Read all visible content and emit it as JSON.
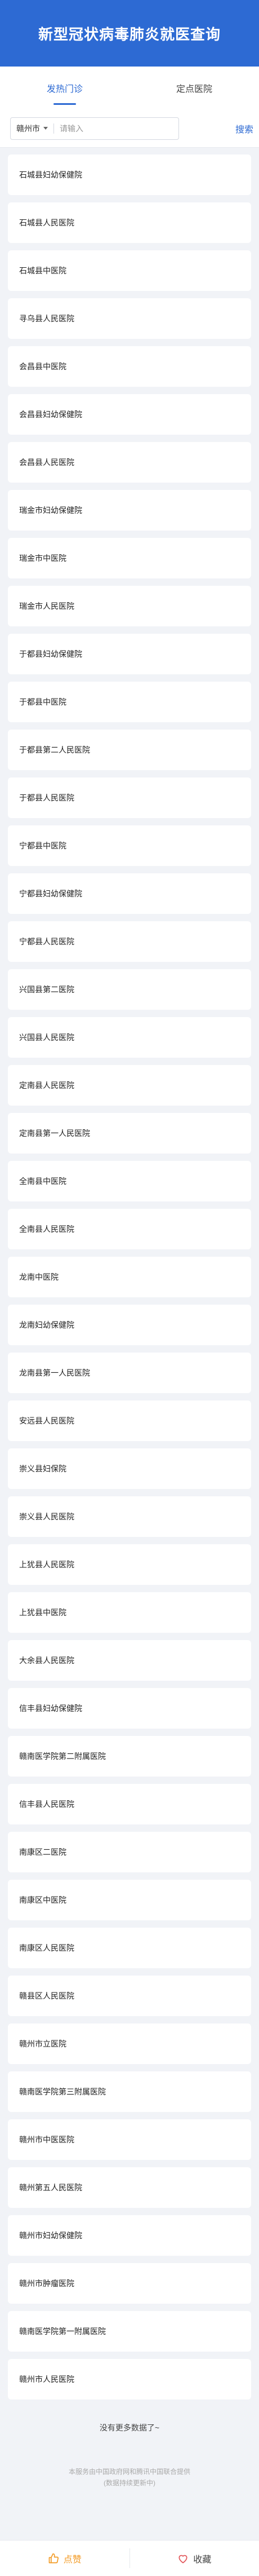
{
  "header": {
    "title": "新型冠状病毒肺炎就医查询"
  },
  "tabs": [
    {
      "label": "发热门诊"
    },
    {
      "label": "定点医院"
    }
  ],
  "search": {
    "city": "赣州市",
    "placeholder": "请输入",
    "button_label": "搜索"
  },
  "hospitals": [
    "石城县妇幼保健院",
    "石城县人民医院",
    "石城县中医院",
    "寻乌县人民医院",
    "会昌县中医院",
    "会昌县妇幼保健院",
    "会昌县人民医院",
    "瑞金市妇幼保健院",
    "瑞金市中医院",
    "瑞金市人民医院",
    "于都县妇幼保健院",
    "于都县中医院",
    "于都县第二人民医院",
    "于都县人民医院",
    "宁都县中医院",
    "宁都县妇幼保健院",
    "宁都县人民医院",
    "兴国县第二医院",
    "兴国县人民医院",
    "定南县人民医院",
    "定南县第一人民医院",
    "全南县中医院",
    "全南县人民医院",
    "龙南中医院",
    "龙南妇幼保健院",
    "龙南县第一人民医院",
    "安远县人民医院",
    "崇义县妇保院",
    "崇义县人民医院",
    "上犹县人民医院",
    "上犹县中医院",
    "大余县人民医院",
    "信丰县妇幼保健院",
    "赣南医学院第二附属医院",
    "信丰县人民医院",
    "南康区二医院",
    "南康区中医院",
    "南康区人民医院",
    "赣县区人民医院",
    "赣州市立医院",
    "赣南医学院第三附属医院",
    "赣州市中医医院",
    "赣州第五人民医院",
    "赣州市妇幼保健院",
    "赣州市肿瘤医院",
    "赣南医学院第一附属医院",
    "赣州市人民医院"
  ],
  "list_end_text": "没有更多数据了~",
  "footer": {
    "line1": "本服务由中国政府网和腾讯中国联合提供",
    "line2": "(数据持续更新中)"
  },
  "bottom_bar": {
    "like_label": "点赞",
    "favorite_label": "收藏"
  },
  "colors": {
    "primary": "#2d6ad3",
    "background": "#f1f3f7",
    "like": "#f39a23"
  }
}
